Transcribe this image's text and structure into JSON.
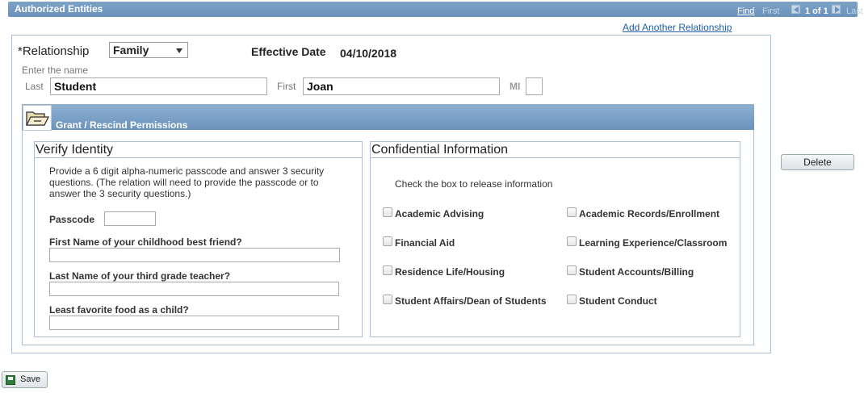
{
  "header": {
    "title": "Authorized Entities",
    "find": "Find",
    "first": "First",
    "count": "1 of 1",
    "last": "Last"
  },
  "add_relationship_link": "Add Another Relationship",
  "relationship": {
    "label": "*Relationship",
    "value": "Family"
  },
  "effective_date": {
    "label": "Effective Date",
    "value": "04/10/2018"
  },
  "name": {
    "hint": "Enter the name",
    "last_label": "Last",
    "last_value": "Student",
    "first_label": "First",
    "first_value": "Joan",
    "mi_label": "MI",
    "mi_value": ""
  },
  "permissions": {
    "title": "Grant / Rescind Permissions"
  },
  "verify": {
    "title": "Verify Identity",
    "description": "Provide a 6 digit alpha-numeric passcode and answer 3 security questions. (The relation will need to provide the passcode or to answer the 3 security questions.)",
    "passcode_label": "Passcode",
    "passcode_value": "",
    "questions": [
      {
        "label": "First Name of your childhood best friend?",
        "value": ""
      },
      {
        "label": "Last Name of your third grade teacher?",
        "value": ""
      },
      {
        "label": "Least favorite food as a child?",
        "value": ""
      }
    ]
  },
  "confidential": {
    "title": "Confidential Information",
    "instruction": "Check the box to release information",
    "items": [
      {
        "label": "Academic Advising",
        "checked": false
      },
      {
        "label": "Academic Records/Enrollment",
        "checked": false
      },
      {
        "label": "Financial Aid",
        "checked": false
      },
      {
        "label": "Learning Experience/Classroom",
        "checked": false
      },
      {
        "label": "Residence Life/Housing",
        "checked": false
      },
      {
        "label": "Student Accounts/Billing",
        "checked": false
      },
      {
        "label": "Student Affairs/Dean of Students",
        "checked": false
      },
      {
        "label": "Student Conduct",
        "checked": false
      }
    ]
  },
  "buttons": {
    "delete": "Delete",
    "save": "Save"
  }
}
